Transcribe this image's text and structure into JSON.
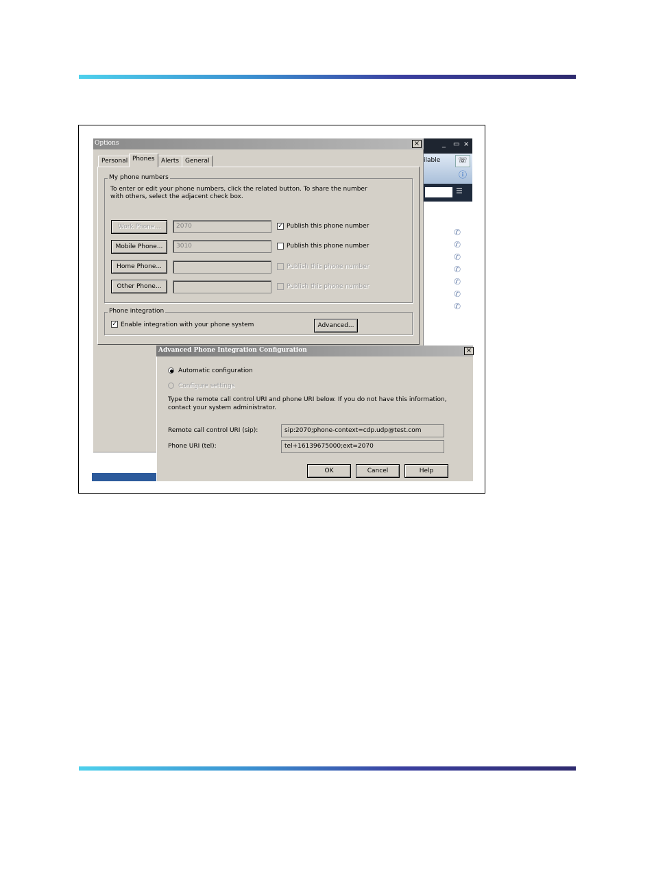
{
  "bg_window": {
    "title_controls": [
      "_",
      "▭",
      "×"
    ],
    "status_fragment": "ilable"
  },
  "options_dialog": {
    "title": "Options",
    "close": "×",
    "tabs": [
      "Personal",
      "Phones",
      "Alerts",
      "General"
    ],
    "active_tab": "Phones",
    "phone_numbers": {
      "legend": "My phone numbers",
      "instructions": "To enter or edit your phone numbers, click the related button. To share the number with others, select the adjacent check box.",
      "rows": [
        {
          "button": "Work Phone...",
          "value": "2070",
          "publish_label": "Publish this phone number",
          "checked": true
        },
        {
          "button": "Mobile Phone...",
          "value": "3010",
          "publish_label": "Publish this phone number",
          "checked": false
        },
        {
          "button": "Home Phone...",
          "value": "",
          "publish_label": "Publish this phone number",
          "checked": false
        },
        {
          "button": "Other Phone...",
          "value": "",
          "publish_label": "Publish this phone number",
          "checked": false
        }
      ]
    },
    "integration": {
      "legend": "Phone integration",
      "enable_label": "Enable integration with your phone system",
      "enabled": true,
      "advanced_button": "Advanced..."
    }
  },
  "advanced_dialog": {
    "title": "Advanced Phone Integration Configuration",
    "close": "×",
    "radio_auto": "Automatic configuration",
    "radio_manual": "Configure settings",
    "selected": "auto",
    "instructions": "Type the remote call control URI and phone URI below. If you do not have this information, contact your system administrator.",
    "remote_label": "Remote call control URI (sip):",
    "remote_value": "sip:2070;phone-context=cdp.udp@test.com",
    "phone_label": "Phone URI (tel):",
    "phone_value": "tel+16139675000;ext=2070",
    "ok": "OK",
    "cancel": "Cancel",
    "help": "Help"
  },
  "colors": {
    "rule_start": "#4dd0ec",
    "rule_end": "#2e2a6e",
    "dialog_face": "#d4d0c8"
  }
}
